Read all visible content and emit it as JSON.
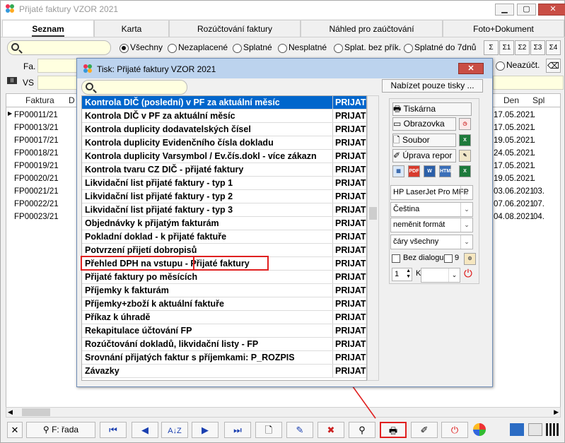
{
  "window": {
    "title": "Přijaté faktury VZOR  2021",
    "min": "▭",
    "max": "▢",
    "close": "✕"
  },
  "tabs": [
    "Seznam",
    "Karta",
    "Rozúčtování faktury",
    "Náhled pro zaúčtování",
    "Foto+Dokument"
  ],
  "filters": [
    "Všechny",
    "Nezaplacené",
    "Splatné",
    "Nesplatné",
    "Splat. bez přík.",
    "Splatné do 7dnů"
  ],
  "sigma_buttons": [
    "Σ",
    "Σ1",
    "Σ2",
    "Σ3",
    "Σ4"
  ],
  "labels": {
    "fa": "Fa.",
    "vs": "VS",
    "neazuct": "Neazúčt."
  },
  "grid": {
    "headers": {
      "faktura": "Faktura",
      "d": "D",
      "den": "Den",
      "spl": "Spl"
    },
    "rows": [
      {
        "faktura": "FP00011/21",
        "den": "17.05.2021",
        "spl": "."
      },
      {
        "faktura": "FP00013/21",
        "den": "17.05.2021",
        "spl": "."
      },
      {
        "faktura": "FP00017/21",
        "den": "19.05.2021",
        "spl": "."
      },
      {
        "faktura": "FP00018/21",
        "den": "24.05.2021",
        "spl": "."
      },
      {
        "faktura": "FP00019/21",
        "den": "17.05.2021",
        "spl": "."
      },
      {
        "faktura": "FP00020/21",
        "den": "19.05.2021",
        "spl": "."
      },
      {
        "faktura": "FP00021/21",
        "den": "03.06.2021",
        "spl": "03."
      },
      {
        "faktura": "FP00022/21",
        "den": "07.06.2021",
        "spl": "07."
      },
      {
        "faktura": "FP00023/21",
        "den": "04.08.2021",
        "spl": "04."
      }
    ]
  },
  "toolbar": {
    "find_label": "F: řada"
  },
  "dialog": {
    "title": "Tisk: Přijaté faktury VZOR  2021",
    "only_prints_button": "Nabízet pouze tisky ...",
    "items": [
      {
        "name": "Kontrola DIČ (poslední) v PF za aktuální měsíc",
        "code": "PRIJAT"
      },
      {
        "name": "Kontrola DIČ v PF za aktuální měsíc",
        "code": "PRIJAT"
      },
      {
        "name": "Kontrola duplicity dodavatelských čísel",
        "code": "PRIJAT"
      },
      {
        "name": "Kontrola duplicity Evidenčního čísla dokladu",
        "code": "PRIJAT"
      },
      {
        "name": "Kontrola duplicity Varsymbol / Ev.čís.dokl - více zákazn",
        "code": "PRIJAT"
      },
      {
        "name": "Kontrola tvaru CZ DIČ - přijaté faktury",
        "code": "PRIJAT"
      },
      {
        "name": "Likvidační list přijaté faktury - typ 1",
        "code": "PRIJAT"
      },
      {
        "name": "Likvidační list přijaté faktury - typ 2",
        "code": "PRIJAT"
      },
      {
        "name": "Likvidační list přijaté faktury - typ 3",
        "code": "PRIJAT"
      },
      {
        "name": "Objednávky k přijatým fakturám",
        "code": "PRIJAT"
      },
      {
        "name": "Pokladní doklad - k přijaté faktuře",
        "code": "PRIJAT"
      },
      {
        "name": "Potvrzení přijetí dobropisů",
        "code": "PRIJAT"
      },
      {
        "name": "Přehled DPH na vstupu - Přijaté faktury",
        "code": "PRIJAT"
      },
      {
        "name": "Přijaté faktury po měsících",
        "code": "PRIJAT"
      },
      {
        "name": "Příjemky k fakturám",
        "code": "PRIJAT"
      },
      {
        "name": "Příjemky+zboží k aktuální faktuře",
        "code": "PRIJAT"
      },
      {
        "name": "Příkaz k úhradě",
        "code": "PRIJAT"
      },
      {
        "name": "Rekapitulace účtování FP",
        "code": "PRIJAT"
      },
      {
        "name": "Rozúčtování dokladů, likvidační listy - FP",
        "code": "PRIJAT"
      },
      {
        "name": "Srovnání přijatých faktur s příjemkami: P_ROZPIS",
        "code": "PRIJAT"
      },
      {
        "name": "Závazky",
        "code": "PRIJAT"
      }
    ],
    "right": {
      "printer_btn": "Tiskárna",
      "screen_btn": "Obrazovka",
      "file_btn": "Soubor",
      "edit_btn": "Úprava repor",
      "printer_combo": "HP LaserJet Pro MFP",
      "lang_combo": "Čeština",
      "format_combo": "neměnit formát",
      "lines_combo": "čáry všechny",
      "no_dialog": "Bez dialogu",
      "count": "9",
      "copies": "1",
      "k": "K"
    }
  }
}
